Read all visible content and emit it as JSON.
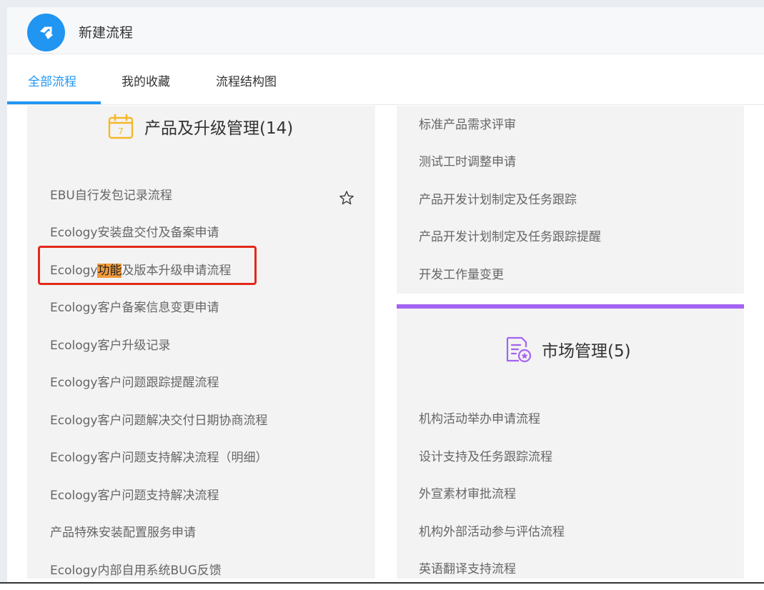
{
  "app": {
    "title": "新建流程"
  },
  "tabs": [
    {
      "label": "全部流程",
      "active": true
    },
    {
      "label": "我的收藏",
      "active": false
    },
    {
      "label": "流程结构图",
      "active": false
    }
  ],
  "categories": {
    "product": {
      "title": "产品及升级管理(14)",
      "icon": "calendar-icon",
      "icon_text": "7",
      "color": "#f5b82a",
      "items": [
        "EBU自行发包记录流程",
        "Ecology安装盘交付及备案申请",
        {
          "before": "Ecology",
          "highlight": "功能",
          "after": "及版本升级申请流程"
        },
        "Ecology客户备案信息变更申请",
        "Ecology客户升级记录",
        "Ecology客户问题跟踪提醒流程",
        "Ecology客户问题解决交付日期协商流程",
        "Ecology客户问题支持解决流程（明细）",
        "Ecology客户问题支持解决流程",
        "产品特殊安装配置服务申请",
        "Ecology内部自用系统BUG反馈"
      ]
    },
    "product_cont": {
      "items": [
        "标准产品需求评审",
        "测试工时调整申请",
        "产品开发计划制定及任务跟踪",
        "产品开发计划制定及任务跟踪提醒",
        "开发工作量变更"
      ]
    },
    "market": {
      "title": "市场管理(5)",
      "icon": "document-badge-icon",
      "color": "#a463f2",
      "items": [
        "机构活动举办申请流程",
        "设计支持及任务跟踪流程",
        "外宣素材审批流程",
        "机构外部活动参与评估流程",
        "英语翻译支持流程"
      ]
    }
  },
  "colors": {
    "accent": "#2196f3",
    "highlight": "#f29b3c",
    "annotation": "#e3291b",
    "panel_bg": "#f3f3f3"
  }
}
